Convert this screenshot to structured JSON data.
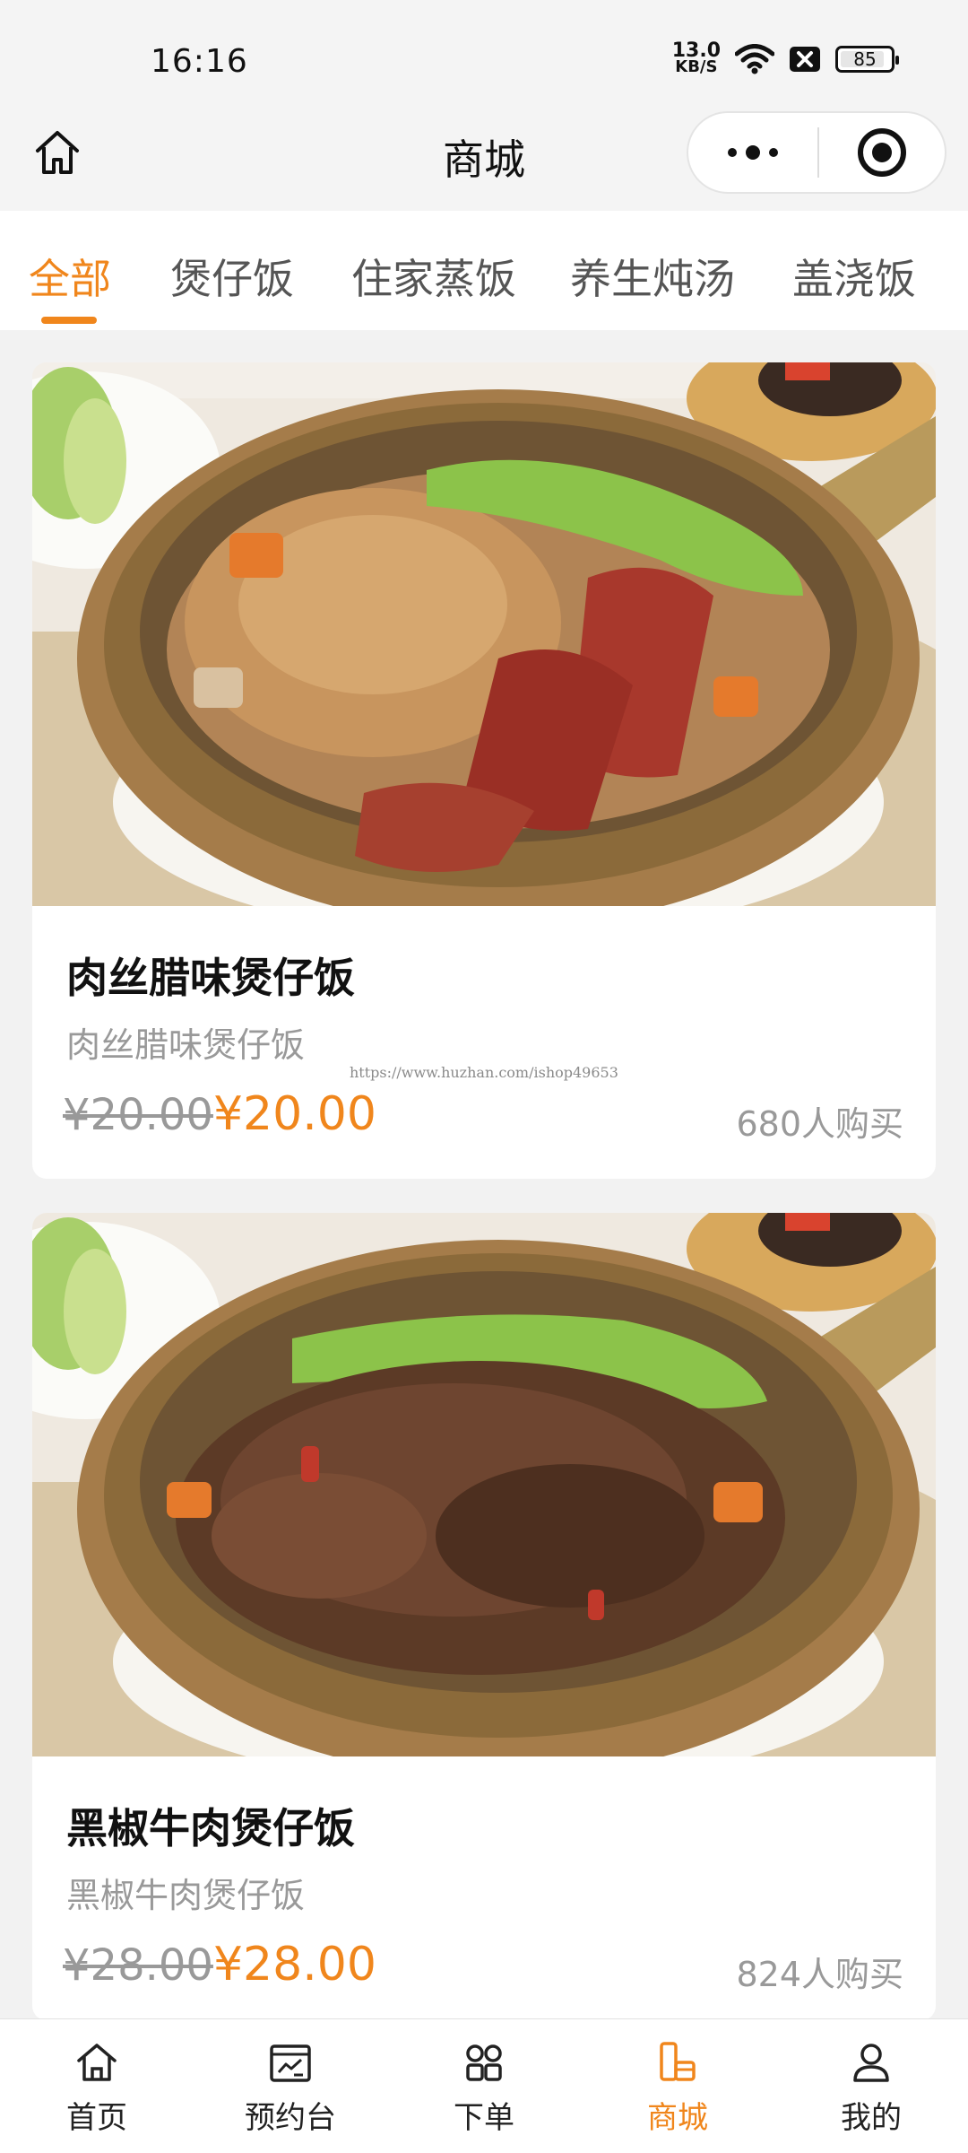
{
  "status_bar": {
    "time": "16:16",
    "net_speed_value": "13.0",
    "net_speed_unit": "KB/S",
    "battery": "85"
  },
  "header": {
    "title": "商城",
    "icons": {
      "home": "home-icon",
      "more": "more-dots-icon",
      "close": "target-close-icon"
    }
  },
  "tabs": [
    {
      "label": "全部",
      "active": true
    },
    {
      "label": "煲仔饭",
      "active": false
    },
    {
      "label": "住家蒸饭",
      "active": false
    },
    {
      "label": "养生炖汤",
      "active": false
    },
    {
      "label": "盖浇饭",
      "active": false
    }
  ],
  "products": [
    {
      "name": "肉丝腊味煲仔饭",
      "desc": "肉丝腊味煲仔饭",
      "old_price": "¥20.00",
      "price": "¥20.00",
      "sold": "680人购买",
      "watermark": "https://www.huzhan.com/ishop49653"
    },
    {
      "name": "黑椒牛肉煲仔饭",
      "desc": "黑椒牛肉煲仔饭",
      "old_price": "¥28.00",
      "price": "¥28.00",
      "sold": "824人购买"
    }
  ],
  "bottom_nav": [
    {
      "label": "首页",
      "icon": "home-icon",
      "active": false
    },
    {
      "label": "预约台",
      "icon": "calendar-board-icon",
      "active": false
    },
    {
      "label": "下单",
      "icon": "grid-icon",
      "active": false
    },
    {
      "label": "商城",
      "icon": "shop-icon",
      "active": true
    },
    {
      "label": "我的",
      "icon": "user-icon",
      "active": false
    }
  ],
  "colors": {
    "accent": "#f0861c",
    "muted": "#999999"
  }
}
